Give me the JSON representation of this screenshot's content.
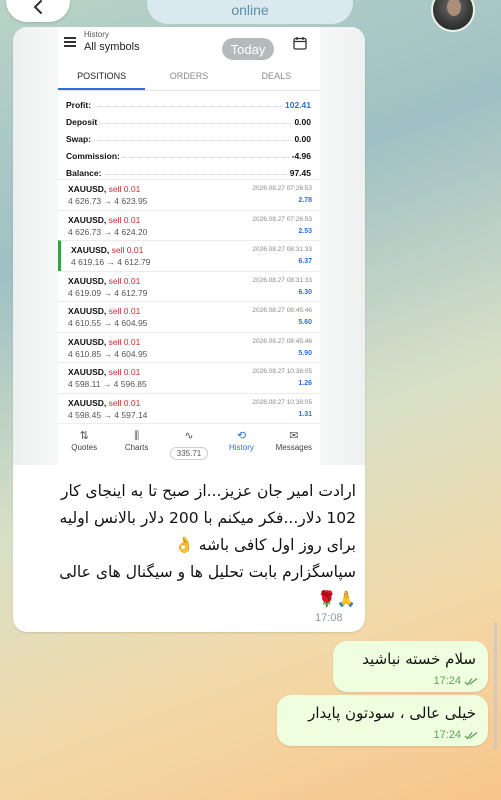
{
  "top_bar": {
    "status": "online"
  },
  "screenshot": {
    "app_subtitle": "History",
    "app_title": "All symbols",
    "date_pill": "Today",
    "tabs": [
      "POSITIONS",
      "ORDERS",
      "DEALS"
    ],
    "active_tab": "POSITIONS",
    "summary": [
      {
        "label": "Profit:",
        "value": "102.41"
      },
      {
        "label": "Deposit",
        "value": "0.00"
      },
      {
        "label": "Swap:",
        "value": "0.00"
      },
      {
        "label": "Commission:",
        "value": "-4.96"
      },
      {
        "label": "Balance:",
        "value": "97.45"
      }
    ],
    "deals": [
      {
        "symbol": "XAUUSD,",
        "side": "sell 0.01",
        "prices": "4 626.73 → 4 623.95",
        "time": "2026.08.27 07:26:53",
        "profit": "2.78"
      },
      {
        "symbol": "XAUUSD,",
        "side": "sell 0.01",
        "prices": "4 626.73 → 4 624.20",
        "time": "2026.08.27 07:26:53",
        "profit": "2.53"
      },
      {
        "symbol": "XAUUSD,",
        "side": "sell 0.01",
        "prices": "4 619.16 → 4 612.79",
        "time": "2026.08.27 08:31:33",
        "profit": "6.37"
      },
      {
        "symbol": "XAUUSD,",
        "side": "sell 0.01",
        "prices": "4 619.09 → 4 612.79",
        "time": "2026.08.27 08:31:33",
        "profit": "6.30"
      },
      {
        "symbol": "XAUUSD,",
        "side": "sell 0.01",
        "prices": "4 610.55 → 4 604.95",
        "time": "2026.08.27 08:45:46",
        "profit": "5.60"
      },
      {
        "symbol": "XAUUSD,",
        "side": "sell 0.01",
        "prices": "4 610.85 → 4 604.95",
        "time": "2026.08.27 08:45:46",
        "profit": "5.90"
      },
      {
        "symbol": "XAUUSD,",
        "side": "sell 0.01",
        "prices": "4 598.11 → 4 596.85",
        "time": "2026.08.27 10:38:05",
        "profit": "1.26"
      },
      {
        "symbol": "XAUUSD,",
        "side": "sell 0.01",
        "prices": "4 598.45 → 4 597.14",
        "time": "2026.08.27 10:38:05",
        "profit": "1.31"
      }
    ],
    "nav": [
      {
        "label": "Quotes",
        "icon": "⇅"
      },
      {
        "label": "Charts",
        "icon": "⫼"
      },
      {
        "label": "335.71",
        "icon": "∿"
      },
      {
        "label": "History",
        "icon": "⟲"
      },
      {
        "label": "Messages",
        "icon": "✉"
      }
    ]
  },
  "incoming": {
    "lines": [
      "ارادت امیر جان عزیز...از صبح تا به اینجای کار",
      "102 دلار...فکر میکنم با 200 دلار بالانس اولیه",
      "برای روز اول کافی باشه 👌",
      "سپاسگزارم بابت تحلیل ها و سیگنال های عالی",
      "🙏🌹"
    ],
    "time": "17:08"
  },
  "outgoing": [
    {
      "text": "سلام خسته نباشید",
      "time": "17:24"
    },
    {
      "text": "خیلی عالی ، سودتون پایدار",
      "time": "17:24"
    }
  ],
  "colors": {
    "accent": "#2f6fdb",
    "sell": "#d02b2b",
    "outgoing_bubble": "#eefedf",
    "check": "#5fa35b"
  }
}
